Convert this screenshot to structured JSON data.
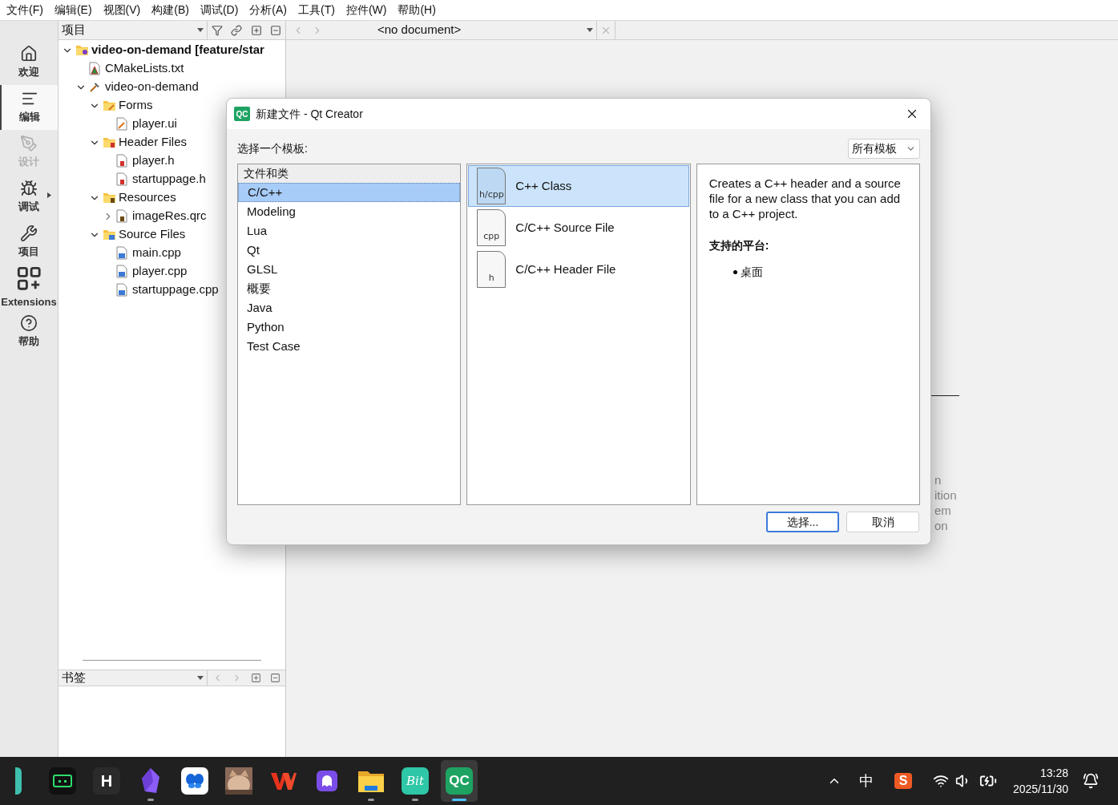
{
  "menu": [
    "文件(F)",
    "编辑(E)",
    "视图(V)",
    "构建(B)",
    "调试(D)",
    "分析(A)",
    "工具(T)",
    "控件(W)",
    "帮助(H)"
  ],
  "toolbar": {
    "view_selector": "项目",
    "document": "<no document>"
  },
  "modes": [
    {
      "label": "欢迎",
      "selected": false,
      "disabled": false
    },
    {
      "label": "编辑",
      "selected": true,
      "disabled": false
    },
    {
      "label": "设计",
      "selected": false,
      "disabled": true
    },
    {
      "label": "调试",
      "selected": false,
      "disabled": false
    },
    {
      "label": "项目",
      "selected": false,
      "disabled": false
    },
    {
      "label": "Extensions",
      "selected": false,
      "disabled": false
    },
    {
      "label": "帮助",
      "selected": false,
      "disabled": false
    }
  ],
  "tree": [
    {
      "label": "video-on-demand [feature/star",
      "kind": "project",
      "expanded": true,
      "children": [
        {
          "label": "CMakeLists.txt",
          "kind": "cmake"
        },
        {
          "label": "video-on-demand",
          "kind": "target",
          "expanded": true,
          "children": [
            {
              "label": "Forms",
              "kind": "formfolder",
              "expanded": true,
              "children": [
                {
                  "label": "player.ui",
                  "kind": "uifile"
                }
              ]
            },
            {
              "label": "Header Files",
              "kind": "headerfolder",
              "expanded": true,
              "children": [
                {
                  "label": "player.h",
                  "kind": "headerfile"
                },
                {
                  "label": "startuppage.h",
                  "kind": "headerfile"
                }
              ]
            },
            {
              "label": "Resources",
              "kind": "resourcefolder",
              "expanded": true,
              "children": [
                {
                  "label": "imageRes.qrc",
                  "kind": "resourcefile",
                  "expanded": false
                }
              ]
            },
            {
              "label": "Source Files",
              "kind": "sourcefolder",
              "expanded": true,
              "children": [
                {
                  "label": "main.cpp",
                  "kind": "sourcefile"
                },
                {
                  "label": "player.cpp",
                  "kind": "sourcefile"
                },
                {
                  "label": "startuppage.cpp",
                  "kind": "sourcefile"
                }
              ]
            }
          ]
        }
      ]
    }
  ],
  "bookmarks": {
    "title": "书签"
  },
  "editor_background": {
    "fragments": [
      "n",
      "ition",
      "em",
      "on"
    ]
  },
  "dialog": {
    "logo": "QC",
    "title": "新建文件 - Qt Creator",
    "prompt": "选择一个模板:",
    "filter": "所有模板",
    "categories_header": "文件和类",
    "categories": [
      {
        "label": "C/C++",
        "selected": true
      },
      {
        "label": "Modeling",
        "selected": false
      },
      {
        "label": "Lua",
        "selected": false
      },
      {
        "label": "Qt",
        "selected": false
      },
      {
        "label": "GLSL",
        "selected": false
      },
      {
        "label": "概要",
        "selected": false
      },
      {
        "label": "Java",
        "selected": false
      },
      {
        "label": "Python",
        "selected": false
      },
      {
        "label": "Test Case",
        "selected": false
      }
    ],
    "templates": [
      {
        "label": "C++ Class",
        "badge": "h/cpp",
        "selected": true
      },
      {
        "label": "C/C++ Source File",
        "badge": "cpp",
        "selected": false
      },
      {
        "label": "C/C++ Header File",
        "badge": "h",
        "selected": false
      }
    ],
    "description": "Creates a C++ header and a source file for a new class that you can add to a C++ project.",
    "platforms_heading": "支持的平台:",
    "platforms": [
      "桌面"
    ],
    "buttons": [
      {
        "label": "选择...",
        "default": true
      },
      {
        "label": "取消",
        "default": false
      }
    ]
  },
  "taskbar": {
    "apps": [
      {
        "running": false,
        "selected": false
      },
      {
        "running": false,
        "selected": false
      },
      {
        "label": "H",
        "running": false,
        "selected": false
      },
      {
        "running": true,
        "selected": false
      },
      {
        "running": false,
        "selected": false
      },
      {
        "running": false,
        "selected": false
      },
      {
        "running": false,
        "selected": false
      },
      {
        "running": false,
        "selected": false
      },
      {
        "running": true,
        "selected": false
      },
      {
        "label": "Bit",
        "running": true,
        "selected": false
      },
      {
        "label": "QC",
        "running": true,
        "selected": true
      }
    ],
    "input_method": "中",
    "ime_logo": "S",
    "time": "13:28",
    "date": "2025/11/30"
  }
}
